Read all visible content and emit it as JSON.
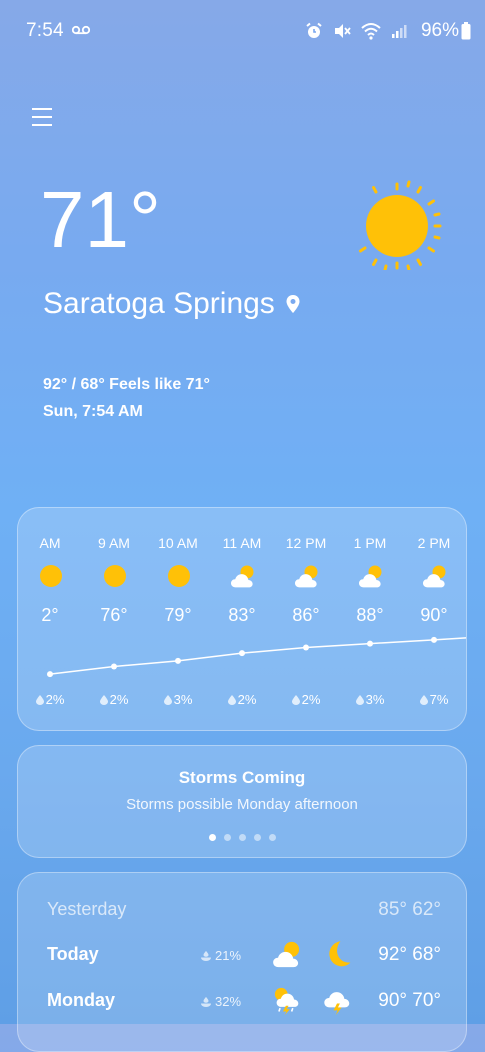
{
  "status_bar": {
    "time": "7:54",
    "battery": "96%",
    "icons": [
      "voicemail-icon",
      "alarm-icon",
      "mute-icon",
      "wifi-icon",
      "signal-icon",
      "battery-icon"
    ]
  },
  "current": {
    "temperature": "71°",
    "location": "Saratoga Springs",
    "hi_lo_feels": "92° / 68° Feels like 71°",
    "datetime": "Sun, 7:54 AM",
    "condition_icon": "sun-icon"
  },
  "hourly": [
    {
      "time": "AM",
      "icon": "sun-icon",
      "temp": "2°",
      "precip": "2%"
    },
    {
      "time": "9 AM",
      "icon": "sun-icon",
      "temp": "76°",
      "precip": "2%"
    },
    {
      "time": "10 AM",
      "icon": "sun-icon",
      "temp": "79°",
      "precip": "3%"
    },
    {
      "time": "11 AM",
      "icon": "partly-cloudy-icon",
      "temp": "83°",
      "precip": "2%"
    },
    {
      "time": "12 PM",
      "icon": "partly-cloudy-icon",
      "temp": "86°",
      "precip": "2%"
    },
    {
      "time": "1 PM",
      "icon": "partly-cloudy-icon",
      "temp": "88°",
      "precip": "3%"
    },
    {
      "time": "2 PM",
      "icon": "partly-cloudy-icon",
      "temp": "90°",
      "precip": "7%"
    }
  ],
  "hourly_trend_values": [
    72,
    76,
    79,
    83,
    86,
    88,
    90
  ],
  "alert": {
    "title": "Storms Coming",
    "description": "Storms possible Monday afternoon",
    "pages": 5,
    "active_page": 0
  },
  "daily": [
    {
      "day": "Yesterday",
      "precip": "",
      "icon1": "",
      "icon2": "",
      "temps": "85° 62°"
    },
    {
      "day": "Today",
      "precip": "21%",
      "icon1": "partly-cloudy-icon",
      "icon2": "moon-icon",
      "temps": "92° 68°"
    },
    {
      "day": "Monday",
      "precip": "32%",
      "icon1": "thunderstorm-sun-icon",
      "icon2": "thunderstorm-icon",
      "temps": "90° 70°"
    }
  ],
  "colors": {
    "sun": "#FFC107",
    "background_top": "#86A9E8",
    "background_bottom": "#5F9FE6"
  }
}
